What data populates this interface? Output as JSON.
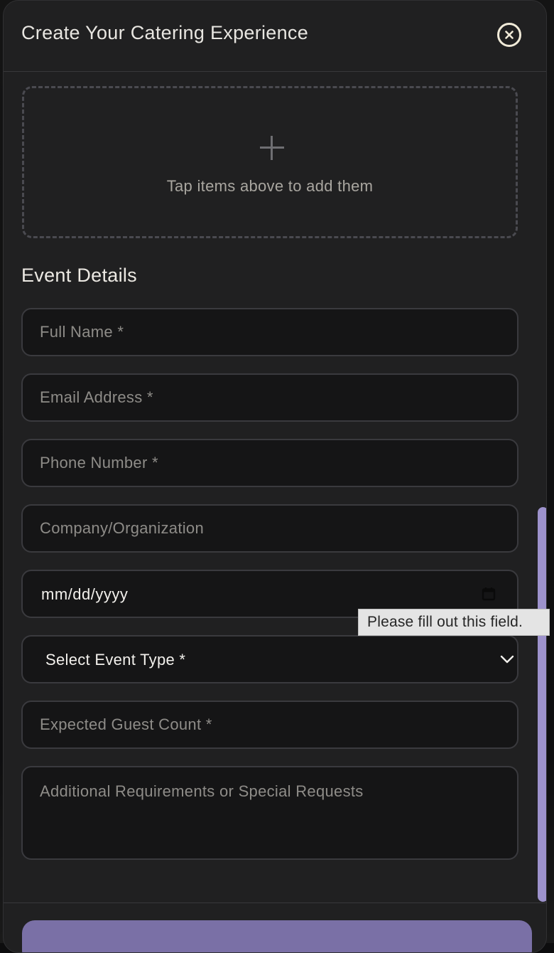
{
  "modal": {
    "title": "Create Your Catering Experience",
    "close_icon": "close-circle-icon"
  },
  "drop_zone": {
    "icon": "plus-icon",
    "text": "Tap items above to add them"
  },
  "event_details": {
    "title": "Event Details",
    "full_name_placeholder": "Full Name *",
    "email_placeholder": "Email Address *",
    "phone_placeholder": "Phone Number *",
    "company_placeholder": "Company/Organization",
    "date_value": "mm/dd/yyyy",
    "event_type_selected": "Select Event Type *",
    "guest_count_placeholder": "Expected Guest Count *",
    "requirements_placeholder": "Additional Requirements or Special Requests"
  },
  "tooltip": {
    "text": "Please fill out this field."
  },
  "colors": {
    "modal_bg": "#202021",
    "field_bg": "#151516",
    "field_border": "#3a3a3e",
    "accent": "#9d92cc",
    "button": "#7a70a6"
  }
}
